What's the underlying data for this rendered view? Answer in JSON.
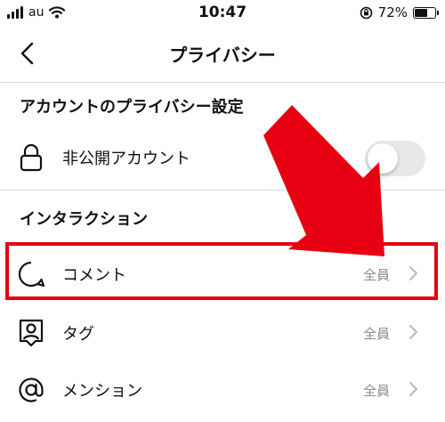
{
  "status_bar": {
    "carrier": "au",
    "time": "10:47",
    "battery_percent": "72%",
    "battery_level": 0.72
  },
  "nav": {
    "title": "プライバシー"
  },
  "account_section": {
    "title": "アカウントのプライバシー設定",
    "private_account": {
      "label": "非公開アカウント",
      "enabled": false
    }
  },
  "interaction_section": {
    "title": "インタラクション",
    "items": [
      {
        "label": "コメント",
        "value": "全員",
        "icon": "comment-icon"
      },
      {
        "label": "タグ",
        "value": "全員",
        "icon": "tag-person-icon"
      },
      {
        "label": "メンション",
        "value": "全員",
        "icon": "at-icon"
      }
    ]
  },
  "colors": {
    "highlight": "#e60012",
    "arrow": "#e60012",
    "toggle_off": "#e8e8ea",
    "value_gray": "#8a8a8a"
  }
}
